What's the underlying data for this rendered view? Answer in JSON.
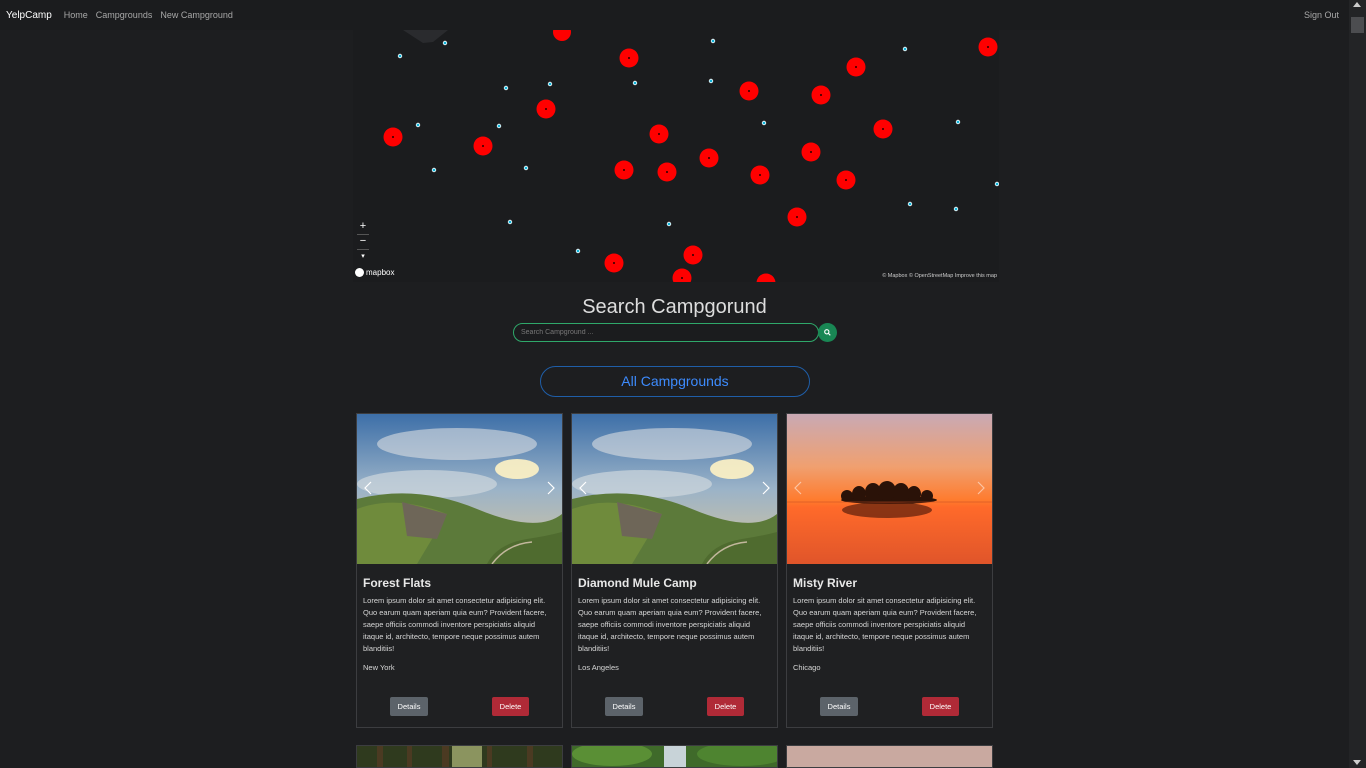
{
  "navbar": {
    "brand": "YelpCamp",
    "links": [
      "Home",
      "Campgrounds",
      "New Campground"
    ],
    "signout": "Sign Out"
  },
  "map": {
    "zoom_in": "+",
    "zoom_out": "−",
    "compass": "▾",
    "logo": "mapbox",
    "attribution": "© Mapbox © OpenStreetMap  Improve this map"
  },
  "search": {
    "title": "Search Campgorund",
    "placeholder": "Search Campground ..."
  },
  "all_button": "All Campgrounds",
  "cards": [
    {
      "title": "Forest Flats",
      "description": "Lorem ipsum dolor sit amet consectetur adipisicing elit. Quo earum quam aperiam quia eum? Provident facere, saepe officiis commodi inventore perspiciatis aliquid itaque id, architecto, tempore neque possimus autem blanditiis!",
      "location": "New York",
      "details": "Details",
      "delete": "Delete"
    },
    {
      "title": "Diamond Mule Camp",
      "description": "Lorem ipsum dolor sit amet consectetur adipisicing elit. Quo earum quam aperiam quia eum? Provident facere, saepe officiis commodi inventore perspiciatis aliquid itaque id, architecto, tempore neque possimus autem blanditiis!",
      "location": "Los Angeles",
      "details": "Details",
      "delete": "Delete"
    },
    {
      "title": "Misty River",
      "description": "Lorem ipsum dolor sit amet consectetur adipisicing elit. Quo earum quam aperiam quia eum? Provident facere, saepe officiis commodi inventore perspiciatis aliquid itaque id, architecto, tempore neque possimus autem blanditiis!",
      "location": "Chicago",
      "details": "Details",
      "delete": "Delete"
    }
  ],
  "colors": {
    "accent_green": "#198754",
    "accent_blue": "#3d8bfd",
    "delete_red": "#b02a37",
    "details_gray": "#5c636a",
    "cluster_red": "#ff0000",
    "point_cyan": "#11b4da"
  }
}
